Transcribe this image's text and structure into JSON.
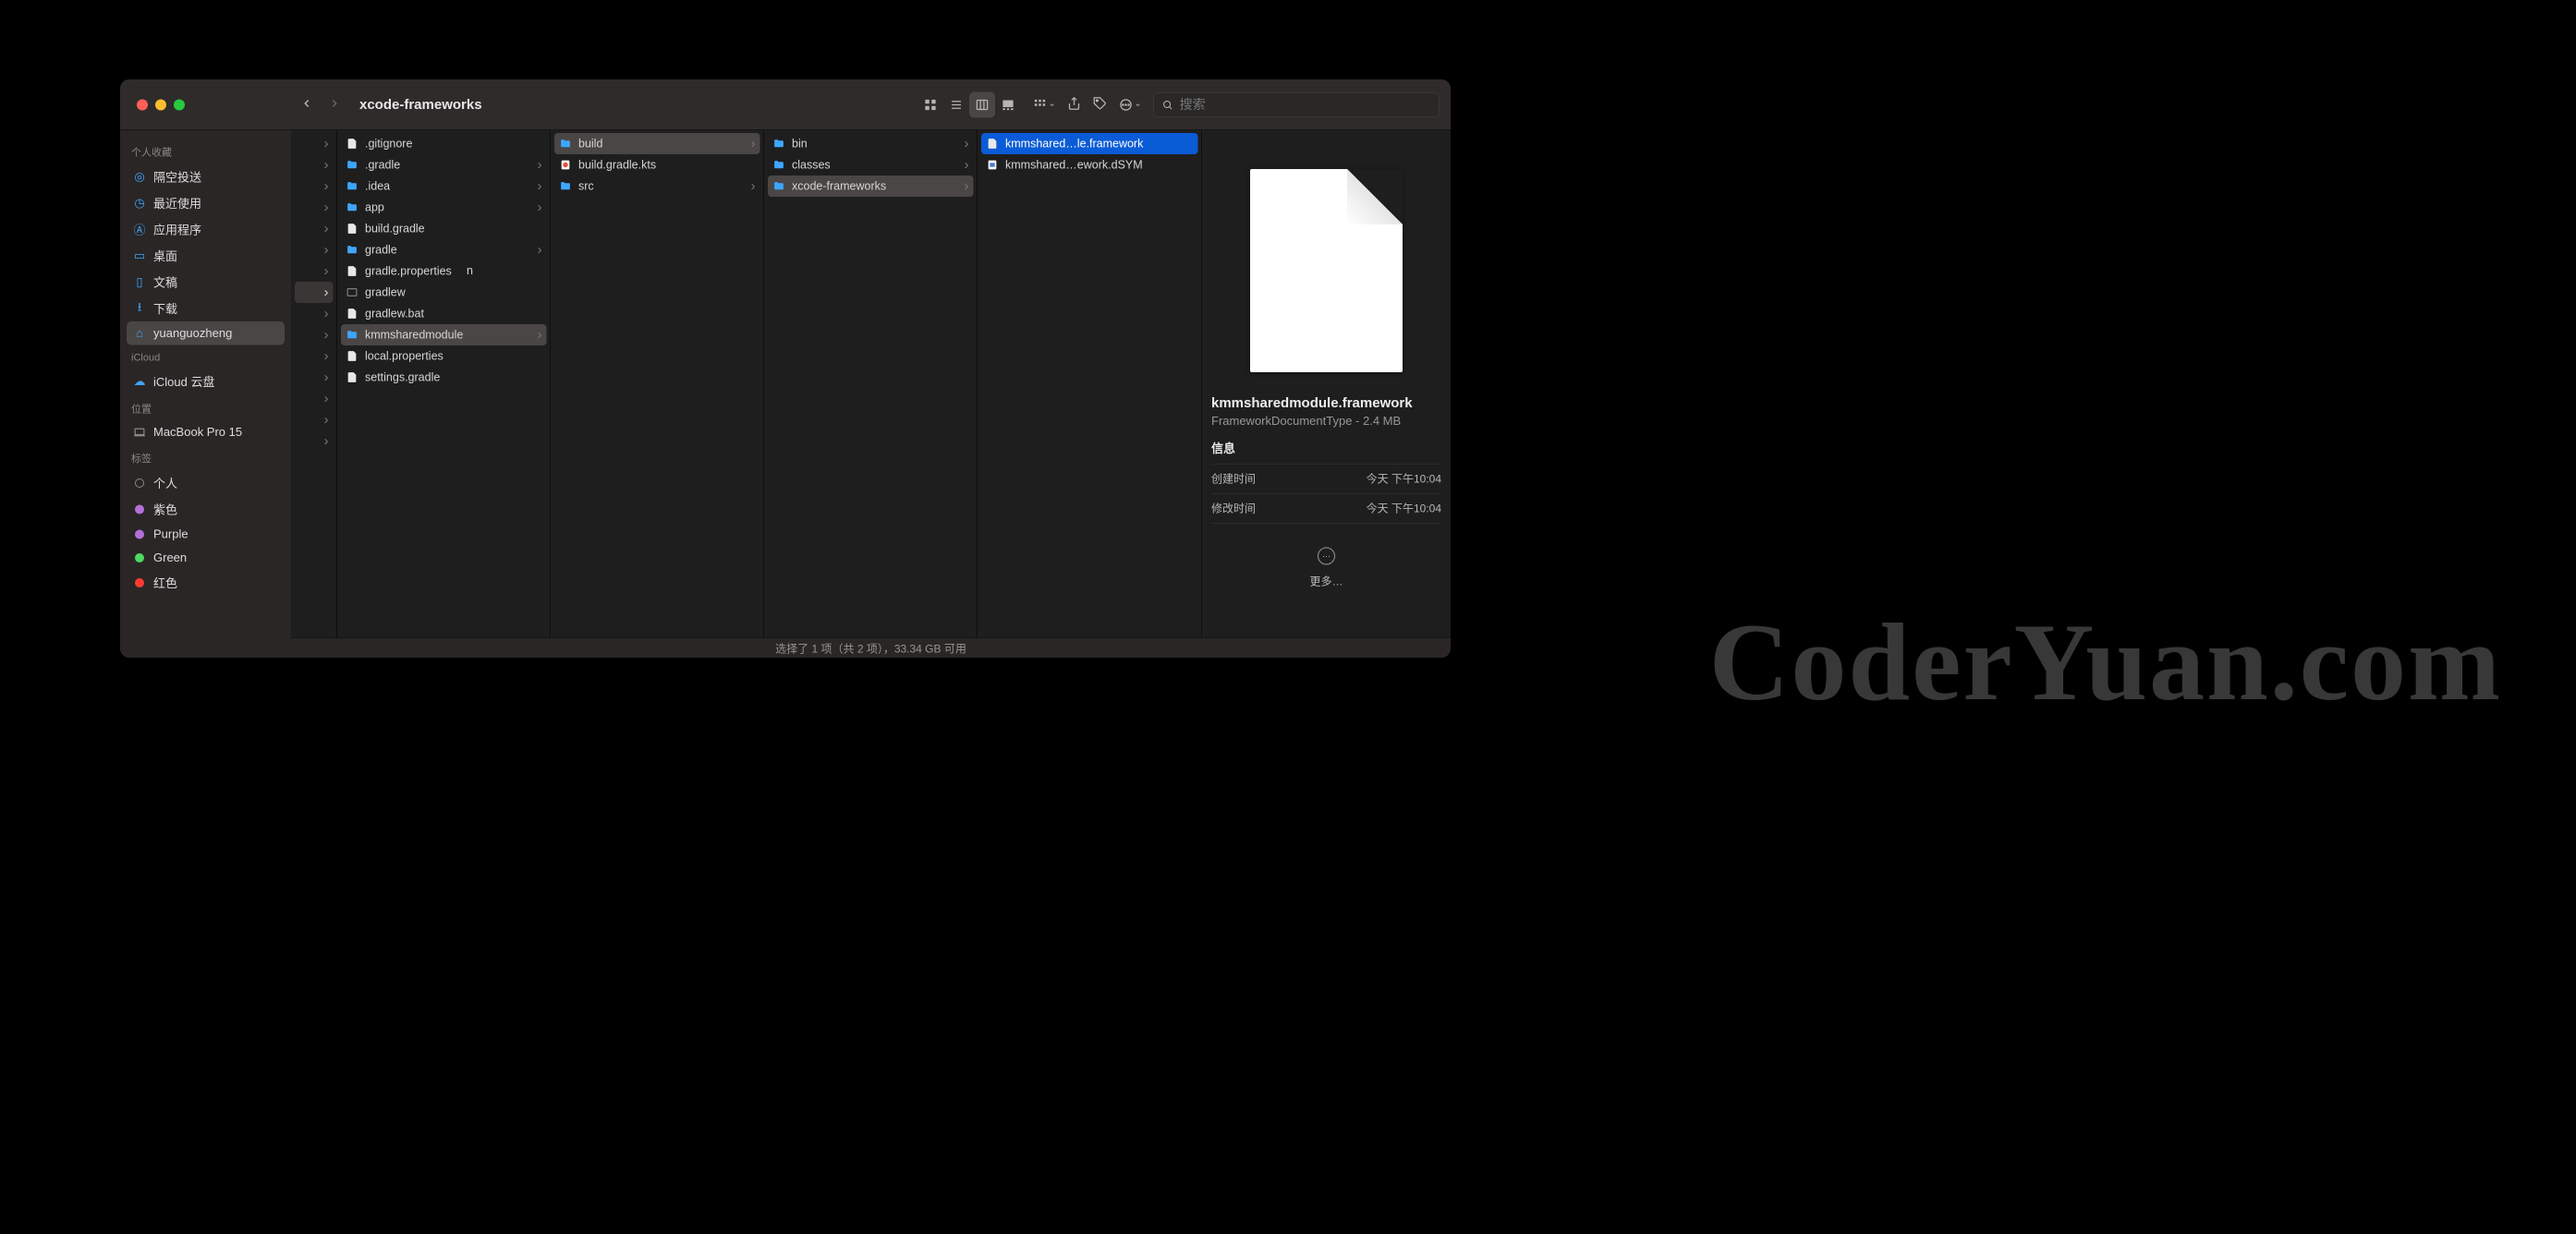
{
  "title": "xcode-frameworks",
  "search_placeholder": "搜索",
  "sidebar": {
    "fav_hdr": "个人收藏",
    "items_fav": [
      {
        "label": "隔空投送",
        "icon": "airdrop"
      },
      {
        "label": "最近使用",
        "icon": "clock"
      },
      {
        "label": "应用程序",
        "icon": "app"
      },
      {
        "label": "桌面",
        "icon": "desktop"
      },
      {
        "label": "文稿",
        "icon": "doc"
      },
      {
        "label": "下载",
        "icon": "download"
      },
      {
        "label": "yuanguozheng",
        "icon": "home",
        "sel": true
      }
    ],
    "icloud_hdr": "iCloud",
    "icloud_item": "iCloud 云盘",
    "loc_hdr": "位置",
    "loc_item": "MacBook Pro 15",
    "tag_hdr": "标签",
    "tags": [
      {
        "label": "个人",
        "color": "#888"
      },
      {
        "label": "紫色",
        "color": "#b46fd8"
      },
      {
        "label": "Purple",
        "color": "#b46fd8"
      },
      {
        "label": "Green",
        "color": "#4cd964"
      },
      {
        "label": "红色",
        "color": "#ff3b30"
      }
    ]
  },
  "col0_peek": "n",
  "columns": [
    [
      {
        "label": ".gitignore",
        "type": "file"
      },
      {
        "label": ".gradle",
        "type": "folder",
        "more": true
      },
      {
        "label": ".idea",
        "type": "folder",
        "more": true
      },
      {
        "label": "app",
        "type": "folder",
        "more": true
      },
      {
        "label": "build.gradle",
        "type": "file"
      },
      {
        "label": "gradle",
        "type": "folder",
        "more": true
      },
      {
        "label": "gradle.properties",
        "type": "file"
      },
      {
        "label": "gradlew",
        "type": "exec"
      },
      {
        "label": "gradlew.bat",
        "type": "file"
      },
      {
        "label": "kmmsharedmodule",
        "type": "folder",
        "more": true,
        "sel": true
      },
      {
        "label": "local.properties",
        "type": "file"
      },
      {
        "label": "settings.gradle",
        "type": "file"
      }
    ],
    [
      {
        "label": "build",
        "type": "folder",
        "more": true,
        "sel": true
      },
      {
        "label": "build.gradle.kts",
        "type": "kts"
      },
      {
        "label": "src",
        "type": "folder",
        "more": true
      }
    ],
    [
      {
        "label": "bin",
        "type": "folder",
        "more": true
      },
      {
        "label": "classes",
        "type": "folder",
        "more": true
      },
      {
        "label": "xcode-frameworks",
        "type": "folder",
        "more": true,
        "sel": true
      }
    ],
    [
      {
        "label": "kmmshared…le.framework",
        "type": "file",
        "selblue": true
      },
      {
        "label": "kmmshared…ework.dSYM",
        "type": "dsym"
      }
    ]
  ],
  "preview": {
    "name": "kmmsharedmodule.framework",
    "sub": "FrameworkDocumentType - 2.4 MB",
    "info_hdr": "信息",
    "created_lbl": "创建时间",
    "created_val": "今天 下午10:04",
    "modified_lbl": "修改时间",
    "modified_val": "今天 下午10:04",
    "more": "更多…"
  },
  "status": "选择了 1 项（共 2 项），33.34 GB 可用",
  "watermark": "CoderYuan.com"
}
